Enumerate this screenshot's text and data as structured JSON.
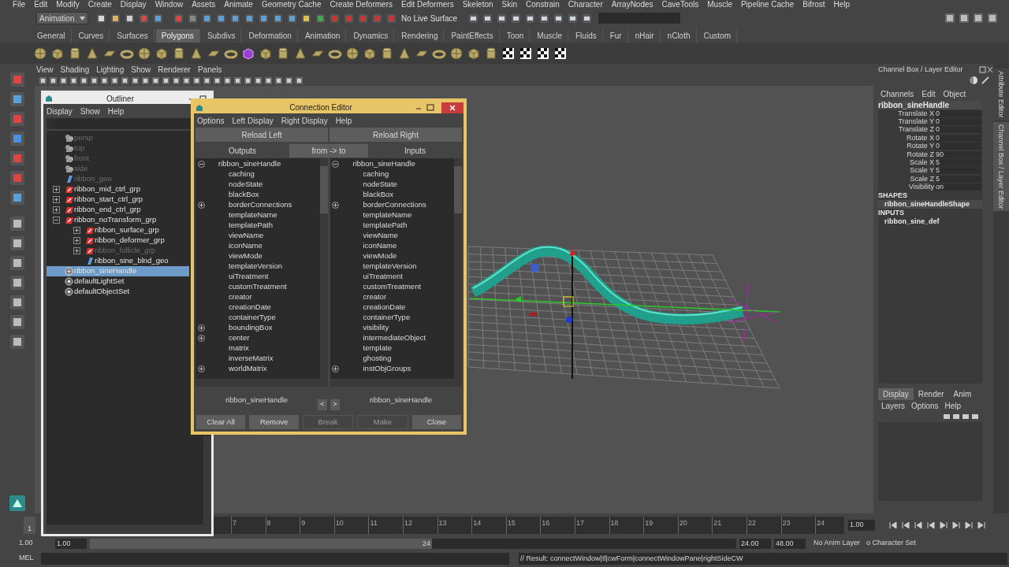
{
  "menu_bar": [
    "File",
    "Edit",
    "Modify",
    "Create",
    "Display",
    "Window",
    "Assets",
    "Animate",
    "Geometry Cache",
    "Create Deformers",
    "Edit Deformers",
    "Skeleton",
    "Skin",
    "Constrain",
    "Character",
    "ArrayNodes",
    "CaveTools",
    "Muscle",
    "Pipeline Cache",
    "Bifrost",
    "Help"
  ],
  "status_line": {
    "mode": "Animation",
    "live_surface": "No Live Surface"
  },
  "shelf": {
    "tabs": [
      {
        "label": "General",
        "selected": false
      },
      {
        "label": "Curves",
        "selected": false
      },
      {
        "label": "Surfaces",
        "selected": false
      },
      {
        "label": "Polygons",
        "selected": true
      },
      {
        "label": "Subdivs",
        "selected": false
      },
      {
        "label": "Deformation",
        "selected": false
      },
      {
        "label": "Animation",
        "selected": false
      },
      {
        "label": "Dynamics",
        "selected": false
      },
      {
        "label": "Rendering",
        "selected": false
      },
      {
        "label": "PaintEffects",
        "selected": false
      },
      {
        "label": "Toon",
        "selected": false
      },
      {
        "label": "Muscle",
        "selected": false
      },
      {
        "label": "Fluids",
        "selected": false
      },
      {
        "label": "Fur",
        "selected": false
      },
      {
        "label": "nHair",
        "selected": false
      },
      {
        "label": "nCloth",
        "selected": false
      },
      {
        "label": "Custom",
        "selected": false
      }
    ]
  },
  "viewport": {
    "menu": [
      "View",
      "Shading",
      "Lighting",
      "Show",
      "Renderer",
      "Panels"
    ]
  },
  "outliner": {
    "title": "Outliner",
    "menu": [
      "Display",
      "Show",
      "Help"
    ],
    "items": [
      {
        "name": "persp",
        "kind": "camera",
        "dimmed": true,
        "selected": false
      },
      {
        "name": "top",
        "kind": "camera",
        "dimmed": true,
        "selected": false
      },
      {
        "name": "front",
        "kind": "camera",
        "dimmed": true,
        "selected": false
      },
      {
        "name": "side",
        "kind": "camera",
        "dimmed": true,
        "selected": false
      },
      {
        "name": "ribbon_geo",
        "kind": "mesh",
        "dimmed": true,
        "selected": false
      },
      {
        "name": "ribbon_mid_ctrl_grp",
        "kind": "group",
        "dimmed": false,
        "selected": false,
        "expanded": false
      },
      {
        "name": "ribbon_start_ctrl_grp",
        "kind": "group",
        "dimmed": false,
        "selected": false,
        "expanded": false
      },
      {
        "name": "ribbon_end_ctrl_grp",
        "kind": "group",
        "dimmed": false,
        "selected": false,
        "expanded": false
      },
      {
        "name": "ribbon_noTransform_grp",
        "kind": "group",
        "dimmed": false,
        "selected": false,
        "expanded": true,
        "children": [
          {
            "name": "ribbon_surface_grp",
            "kind": "group",
            "dimmed": false,
            "selected": false,
            "expanded": false
          },
          {
            "name": "ribbon_deformer_grp",
            "kind": "group",
            "dimmed": false,
            "selected": false,
            "expanded": false
          },
          {
            "name": "ribbon_follicle_grp",
            "kind": "group",
            "dimmed": true,
            "selected": false,
            "expanded": false
          },
          {
            "name": "ribbon_sine_blnd_geo",
            "kind": "mesh",
            "dimmed": false,
            "selected": false
          }
        ]
      },
      {
        "name": "ribbon_sineHandle",
        "kind": "handle",
        "dimmed": false,
        "selected": true
      },
      {
        "name": "defaultLightSet",
        "kind": "set",
        "dimmed": false,
        "selected": false
      },
      {
        "name": "defaultObjectSet",
        "kind": "set",
        "dimmed": false,
        "selected": false
      }
    ]
  },
  "connection_editor": {
    "title": "Connection Editor",
    "menu": [
      "Options",
      "Left Display",
      "Right Display",
      "Help"
    ],
    "reload": [
      "Reload Left",
      "Reload Right"
    ],
    "header": [
      {
        "label": "Outputs",
        "kind": "label"
      },
      {
        "label": "from -> to",
        "kind": "button"
      },
      {
        "label": "Inputs",
        "kind": "label"
      }
    ],
    "left": {
      "node": "ribbon_sineHandle",
      "expanded": true,
      "attributes": [
        {
          "name": "caching",
          "expandable": false
        },
        {
          "name": "nodeState",
          "expandable": false
        },
        {
          "name": "blackBox",
          "expandable": false
        },
        {
          "name": "borderConnections",
          "expandable": true
        },
        {
          "name": "templateName",
          "expandable": false
        },
        {
          "name": "templatePath",
          "expandable": false
        },
        {
          "name": "viewName",
          "expandable": false
        },
        {
          "name": "iconName",
          "expandable": false
        },
        {
          "name": "viewMode",
          "expandable": false
        },
        {
          "name": "templateVersion",
          "expandable": false
        },
        {
          "name": "uiTreatment",
          "expandable": false
        },
        {
          "name": "customTreatment",
          "expandable": false
        },
        {
          "name": "creator",
          "expandable": false
        },
        {
          "name": "creationDate",
          "expandable": false
        },
        {
          "name": "containerType",
          "expandable": false
        },
        {
          "name": "boundingBox",
          "expandable": true
        },
        {
          "name": "center",
          "expandable": true
        },
        {
          "name": "matrix",
          "expandable": false
        },
        {
          "name": "inverseMatrix",
          "expandable": false
        },
        {
          "name": "worldMatrix",
          "expandable": true
        }
      ]
    },
    "right": {
      "node": "ribbon_sineHandle",
      "expanded": true,
      "attributes": [
        {
          "name": "caching",
          "expandable": false
        },
        {
          "name": "nodeState",
          "expandable": false
        },
        {
          "name": "blackBox",
          "expandable": false
        },
        {
          "name": "borderConnections",
          "expandable": true
        },
        {
          "name": "templateName",
          "expandable": false
        },
        {
          "name": "templatePath",
          "expandable": false
        },
        {
          "name": "viewName",
          "expandable": false
        },
        {
          "name": "iconName",
          "expandable": false
        },
        {
          "name": "viewMode",
          "expandable": false
        },
        {
          "name": "templateVersion",
          "expandable": false
        },
        {
          "name": "uiTreatment",
          "expandable": false
        },
        {
          "name": "customTreatment",
          "expandable": false
        },
        {
          "name": "creator",
          "expandable": false
        },
        {
          "name": "creationDate",
          "expandable": false
        },
        {
          "name": "containerType",
          "expandable": false
        },
        {
          "name": "visibility",
          "expandable": false
        },
        {
          "name": "intermediateObject",
          "expandable": false
        },
        {
          "name": "template",
          "expandable": false
        },
        {
          "name": "ghosting",
          "expandable": false
        },
        {
          "name": "instObjGroups",
          "expandable": true
        }
      ]
    },
    "left_label": "ribbon_sineHandle",
    "right_label": "ribbon_sineHandle",
    "prev": "<",
    "next": ">",
    "buttons": [
      {
        "label": "Clear All",
        "disabled": false
      },
      {
        "label": "Remove",
        "disabled": false
      },
      {
        "label": "Break",
        "disabled": true
      },
      {
        "label": "Make",
        "disabled": true
      },
      {
        "label": "Close",
        "disabled": false
      }
    ]
  },
  "channel_box": {
    "title": "Channel Box / Layer Editor",
    "menu": [
      "Channels",
      "Edit",
      "Object"
    ],
    "node": "ribbon_sineHandle",
    "channels": [
      {
        "label": "Translate X",
        "value": "0"
      },
      {
        "label": "Translate Y",
        "value": "0"
      },
      {
        "label": "Translate Z",
        "value": "0"
      },
      {
        "label": "Rotate X",
        "value": "0"
      },
      {
        "label": "Rotate Y",
        "value": "0"
      },
      {
        "label": "Rotate Z",
        "value": "90"
      },
      {
        "label": "Scale X",
        "value": "5"
      },
      {
        "label": "Scale Y",
        "value": "5"
      },
      {
        "label": "Scale Z",
        "value": "5"
      },
      {
        "label": "Visibility",
        "value": "on"
      }
    ],
    "shapes_header": "SHAPES",
    "shapes": [
      "ribbon_sineHandleShape"
    ],
    "inputs_header": "INPUTS",
    "inputs": [
      "ribbon_sine_def"
    ],
    "side_tabs": [
      "Attribute Editor",
      "Channel Box / Layer Editor"
    ]
  },
  "layer_editor": {
    "tabs": [
      {
        "label": "Display",
        "selected": true
      },
      {
        "label": "Render",
        "selected": false
      },
      {
        "label": "Anim",
        "selected": false
      }
    ],
    "menu": [
      "Layers",
      "Options",
      "Help"
    ]
  },
  "time_slider": {
    "current_frame": "1",
    "ticks": [
      "7",
      "8",
      "9",
      "10",
      "11",
      "12",
      "13",
      "14",
      "15",
      "16",
      "17",
      "18",
      "19",
      "20",
      "21",
      "22",
      "23",
      "24"
    ],
    "current_time": "1.00"
  },
  "range_slider": {
    "start": "1.00",
    "range_start": "1.00",
    "range_end_label": "24",
    "range_end": "24.00",
    "end": "48.00",
    "anim_layer": "No Anim Layer",
    "character_set": "o Character Set"
  },
  "command_line": {
    "label": "MEL",
    "result": "// Result: connectWindow|tl|cwForm|connectWindowPane|rightSideCW"
  }
}
